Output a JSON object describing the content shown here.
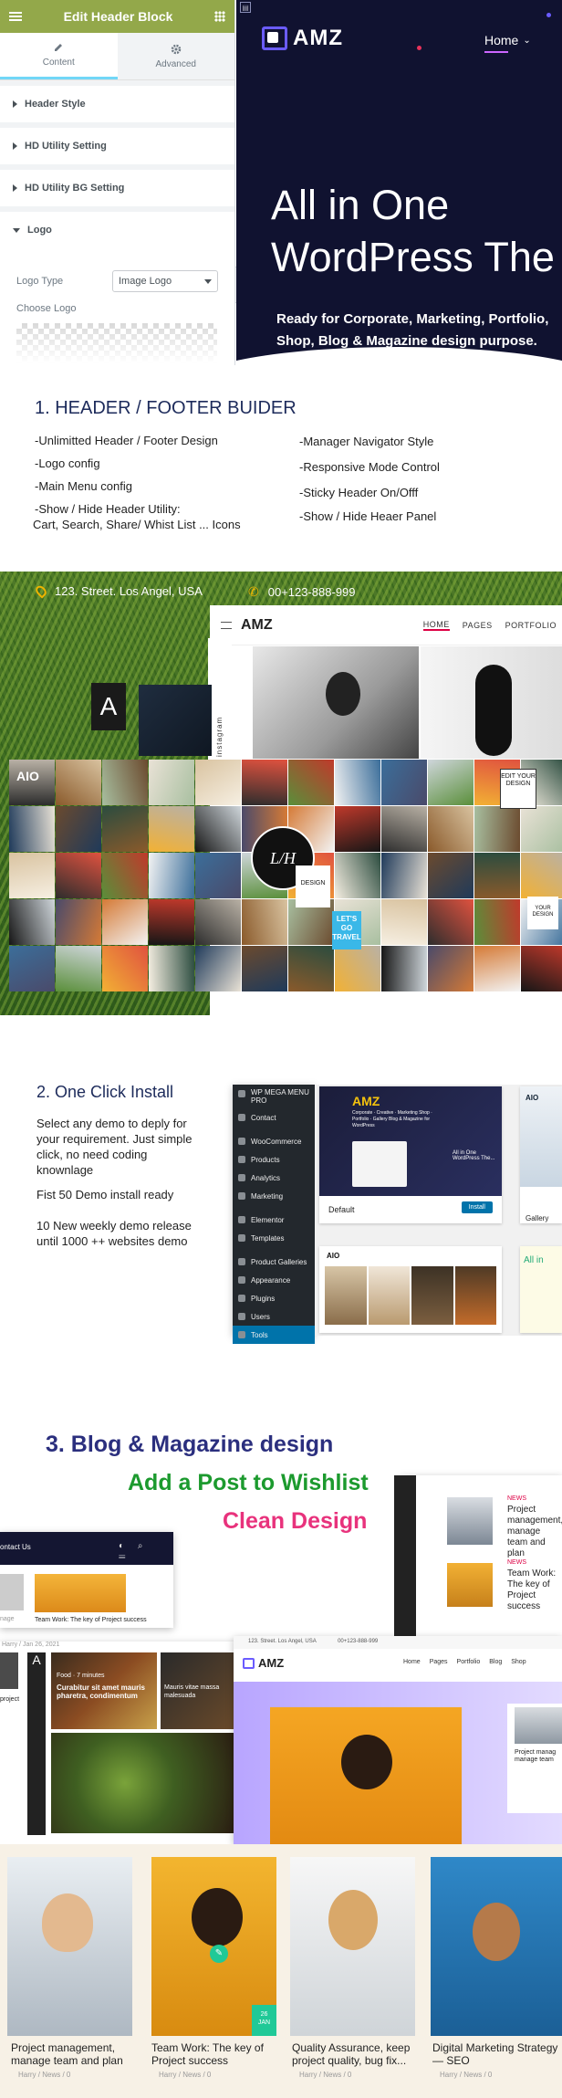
{
  "editor": {
    "title": "Edit Header Block",
    "tabs": [
      {
        "label": "Content"
      },
      {
        "label": "Advanced"
      }
    ],
    "sections": [
      {
        "label": "Header Style"
      },
      {
        "label": "HD Utility Setting"
      },
      {
        "label": "HD Utility BG Setting"
      },
      {
        "label": "Logo"
      }
    ],
    "logo_type_label": "Logo Type",
    "logo_type_value": "Image Logo",
    "choose_logo_label": "Choose Logo"
  },
  "hero": {
    "brand": "AMZ",
    "nav_home": "Home",
    "title_line1": "All in One",
    "title_line2": "WordPress The",
    "subtitle_line1": "Ready for Corporate, Marketing, Portfolio,",
    "subtitle_line2": "Shop, Blog & Magazine design purpose."
  },
  "features": {
    "heading": "1. HEADER / FOOTER BUIDER",
    "left": [
      "-Unlimitted Header / Footer Design",
      "-Logo config",
      "-Main Menu config",
      "-Show / Hide Header Utility:",
      "Cart, Search, Share/ Whist List ... Icons"
    ],
    "right": [
      "-Manager Navigator Style",
      "-Responsive Mode Control",
      "-Sticky Header On/Offf",
      "-Show / Hide Heaer Panel"
    ]
  },
  "showcase": {
    "address": "123. Street. Los Angel, USA",
    "phone": "00+123-888-999",
    "brand": "AMZ",
    "nav": [
      "HOME",
      "PAGES",
      "PORTFOLIO"
    ],
    "instagram_label": "instagram",
    "tile_letter": "A",
    "aio_label": "AIO",
    "center_logo": "L/H",
    "tile_texts": [
      "EDIT YOUR DESIGN",
      "DESIGN",
      "LET'S GO TRAVEL",
      "YOUR DESIGN"
    ]
  },
  "install": {
    "heading": "2. One Click Install",
    "p1": "Select any demo to deply for your requirement. Just simple click, no need coding knownlage",
    "p2": "Fist 50 Demo install ready",
    "p3": "10 New weekly demo release until 1000 ++ websites demo",
    "wp_menu": [
      "WP MEGA MENU PRO",
      "Contact",
      "WooCommerce",
      "Products",
      "Analytics",
      "Marketing",
      "Elementor",
      "Templates",
      "Product Galleries",
      "Appearance",
      "Plugins",
      "Users",
      "Tools"
    ],
    "demo_default": "Default",
    "install_btn": "Install",
    "demo_gallery": "Gallery",
    "demo_brand": "AMZ",
    "demo_tagline": "Corporate · Creative · Marketing Shop · Portfolio · Gallery Blog & Magazine for WordPress",
    "demo_aio_title": "All in One WordPress The...",
    "aio_label": "AIO",
    "aio_right": "All in"
  },
  "blog": {
    "heading1": "3. Blog & Magazine design",
    "heading2": "Add a Post to Wishlist",
    "heading3": "Clean Design",
    "colors": {
      "h1": "#2b2f7e",
      "h2": "#1c9a2e",
      "h3": "#e8327c"
    },
    "side_posts": [
      {
        "tag": "NEWS",
        "title": "Project management, manage team and plan"
      },
      {
        "tag": "NEWS",
        "title": "Team Work: The key of Project success"
      }
    ],
    "left_card_title": "Team Work: The key of Project success",
    "left_card_meta": "Harry / Jan 26, 2021",
    "left_contact": "ontact Us",
    "left_nage": "nage",
    "left_project": "project",
    "food_time": "Food · 7 minutes",
    "food_title": "Curabitur sit amet mauris pharetra, condimentum",
    "food_title2": "Mauris vitae massa malesuada",
    "amz_address": "123. Street. Los Angel, USA",
    "amz_phone": "00+123-888-999",
    "amz_brand": "AMZ",
    "amz_nav": [
      "Home",
      "Pages",
      "Portfolio",
      "Blog",
      "Shop"
    ],
    "right_post": "Project manag manage team",
    "bottom_cards": [
      {
        "title": "Project management, manage team and plan",
        "meta": "Harry / News / 0"
      },
      {
        "title": "Team Work: The key of Project success",
        "meta": "Harry / News / 0"
      },
      {
        "title": "Quality Assurance, keep project quality, bug fix...",
        "meta": "Harry / News / 0"
      },
      {
        "title": "Digital Marketing Strategy — SEO",
        "meta": "Harry / News / 0"
      }
    ],
    "date_badge_day": "26",
    "date_badge_mon": "JAN"
  }
}
